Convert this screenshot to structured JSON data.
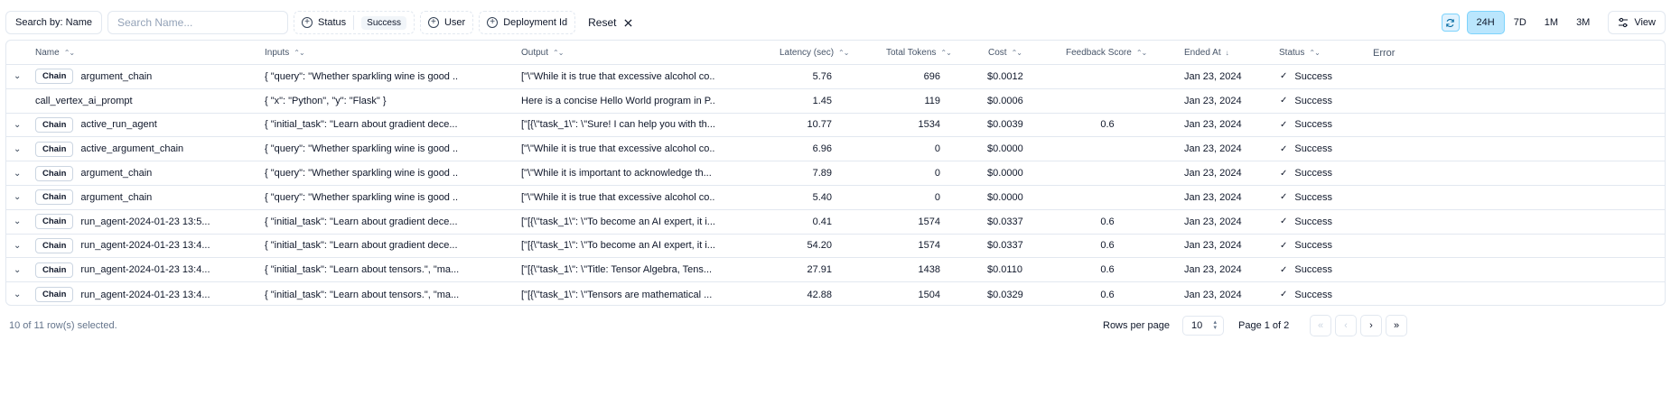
{
  "toolbar": {
    "search_by_label": "Search by: Name",
    "search_placeholder": "Search Name...",
    "filters": {
      "status_label": "Status",
      "status_value": "Success",
      "user_label": "User",
      "deployment_label": "Deployment Id"
    },
    "reset_label": "Reset",
    "time_ranges": [
      "24H",
      "7D",
      "1M",
      "3M"
    ],
    "active_range": "24H",
    "view_label": "View"
  },
  "table": {
    "columns": {
      "name": "Name",
      "inputs": "Inputs",
      "output": "Output",
      "latency": "Latency (sec)",
      "tokens": "Total Tokens",
      "cost": "Cost",
      "feedback": "Feedback Score",
      "ended": "Ended At",
      "status": "Status",
      "error": "Error"
    },
    "chain_badge": "Chain",
    "rows": [
      {
        "name": "argument_chain",
        "chain": true,
        "inputs": "{ \"query\": \"Whether sparkling wine is good ...",
        "output": "[\"\\\"While it is true that excessive alcohol co...",
        "latency": "5.76",
        "tokens": "696",
        "cost": "$0.0012",
        "feedback": "",
        "ended": "Jan 23, 2024",
        "status": "Success"
      },
      {
        "name": "call_vertex_ai_prompt",
        "chain": false,
        "inputs": "{ \"x\": \"Python\", \"y\": \"Flask\" }",
        "output": "Here is a concise Hello World program in P...",
        "latency": "1.45",
        "tokens": "119",
        "cost": "$0.0006",
        "feedback": "",
        "ended": "Jan 23, 2024",
        "status": "Success"
      },
      {
        "name": "active_run_agent",
        "chain": true,
        "inputs": "{ \"initial_task\": \"Learn about gradient dece...",
        "output": "[\"[{\\\"task_1\\\": \\\"Sure! I can help you with th...",
        "latency": "10.77",
        "tokens": "1534",
        "cost": "$0.0039",
        "feedback": "0.6",
        "ended": "Jan 23, 2024",
        "status": "Success"
      },
      {
        "name": "active_argument_chain",
        "chain": true,
        "inputs": "{ \"query\": \"Whether sparkling wine is good ...",
        "output": "[\"\\\"While it is true that excessive alcohol co...",
        "latency": "6.96",
        "tokens": "0",
        "cost": "$0.0000",
        "feedback": "",
        "ended": "Jan 23, 2024",
        "status": "Success"
      },
      {
        "name": "argument_chain",
        "chain": true,
        "inputs": "{ \"query\": \"Whether sparkling wine is good ...",
        "output": "[\"\\\"While it is important to acknowledge th...",
        "latency": "7.89",
        "tokens": "0",
        "cost": "$0.0000",
        "feedback": "",
        "ended": "Jan 23, 2024",
        "status": "Success"
      },
      {
        "name": "argument_chain",
        "chain": true,
        "inputs": "{ \"query\": \"Whether sparkling wine is good ...",
        "output": "[\"\\\"While it is true that excessive alcohol co...",
        "latency": "5.40",
        "tokens": "0",
        "cost": "$0.0000",
        "feedback": "",
        "ended": "Jan 23, 2024",
        "status": "Success"
      },
      {
        "name": "run_agent-2024-01-23 13:5...",
        "chain": true,
        "inputs": "{ \"initial_task\": \"Learn about gradient dece...",
        "output": "[\"[{\\\"task_1\\\": \\\"To become an AI expert, it i...",
        "latency": "0.41",
        "tokens": "1574",
        "cost": "$0.0337",
        "feedback": "0.6",
        "ended": "Jan 23, 2024",
        "status": "Success"
      },
      {
        "name": "run_agent-2024-01-23 13:4...",
        "chain": true,
        "inputs": "{ \"initial_task\": \"Learn about gradient dece...",
        "output": "[\"[{\\\"task_1\\\": \\\"To become an AI expert, it i...",
        "latency": "54.20",
        "tokens": "1574",
        "cost": "$0.0337",
        "feedback": "0.6",
        "ended": "Jan 23, 2024",
        "status": "Success"
      },
      {
        "name": "run_agent-2024-01-23 13:4...",
        "chain": true,
        "inputs": "{ \"initial_task\": \"Learn about tensors.\", \"ma...",
        "output": "[\"[{\\\"task_1\\\": \\\"Title: Tensor Algebra, Tens...",
        "latency": "27.91",
        "tokens": "1438",
        "cost": "$0.0110",
        "feedback": "0.6",
        "ended": "Jan 23, 2024",
        "status": "Success"
      },
      {
        "name": "run_agent-2024-01-23 13:4...",
        "chain": true,
        "inputs": "{ \"initial_task\": \"Learn about tensors.\", \"ma...",
        "output": "[\"[{\\\"task_1\\\": \\\"Tensors are mathematical ...",
        "latency": "42.88",
        "tokens": "1504",
        "cost": "$0.0329",
        "feedback": "0.6",
        "ended": "Jan 23, 2024",
        "status": "Success"
      }
    ]
  },
  "footer": {
    "selection_text": "10 of 11 row(s) selected.",
    "rows_per_page_label": "Rows per page",
    "rows_per_page_value": "10",
    "page_text": "Page 1 of 2"
  }
}
